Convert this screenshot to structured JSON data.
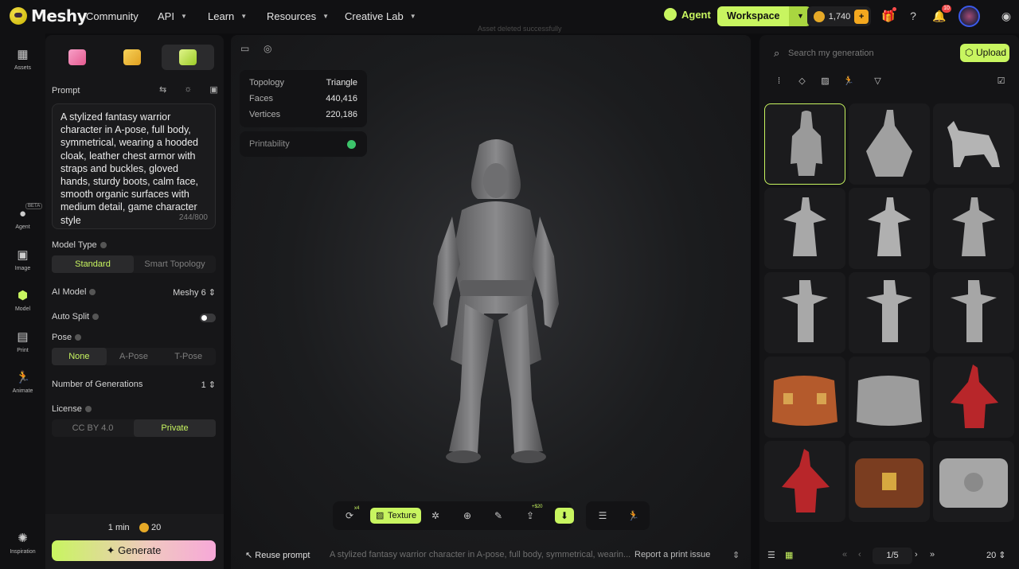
{
  "brand": {
    "name": "Meshy"
  },
  "nav": [
    {
      "label": "Community",
      "dropdown": false
    },
    {
      "label": "API",
      "dropdown": true
    },
    {
      "label": "Learn",
      "dropdown": true
    },
    {
      "label": "Resources",
      "dropdown": true
    },
    {
      "label": "Creative Lab",
      "dropdown": true
    }
  ],
  "header": {
    "agent_label": "Agent",
    "workspace_label": "Workspace",
    "credits": "1,740",
    "notification_count": "10"
  },
  "rail": {
    "items": [
      {
        "label": "Assets",
        "icon": "grid-icon"
      },
      {
        "label": "Agent",
        "icon": "agent-icon",
        "badge": "BETA"
      },
      {
        "label": "Image",
        "icon": "image-plus-icon"
      },
      {
        "label": "Model",
        "icon": "cube-icon"
      },
      {
        "label": "Print",
        "icon": "printer-icon"
      },
      {
        "label": "Animate",
        "icon": "running-figure-icon"
      },
      {
        "label": "Inspiration",
        "icon": "sparkle-icon"
      }
    ]
  },
  "left_panel": {
    "prompt_label": "Prompt",
    "prompt_text": "A stylized fantasy warrior character in A-pose, full body, symmetrical, wearing a hooded cloak, leather chest armor with straps and buckles, gloved hands, sturdy boots, calm face, smooth organic surfaces with medium detail, game character style",
    "prompt_count": "244/800",
    "model_type_label": "Model Type",
    "model_types": [
      "Standard",
      "Smart Topology"
    ],
    "ai_model_label": "AI Model",
    "ai_model_value": "Meshy 6",
    "auto_split_label": "Auto Split",
    "auto_split_on": false,
    "pose_label": "Pose",
    "poses": [
      "None",
      "A-Pose",
      "T-Pose"
    ],
    "generations_label": "Number of Generations",
    "generations_value": "1",
    "license_label": "License",
    "licenses": [
      "CC BY 4.0",
      "Private"
    ],
    "time": "1 min",
    "cost": "20",
    "generate_label": "Generate"
  },
  "viewport": {
    "toast": "Asset deleted successfully",
    "stats": [
      {
        "key": "Topology",
        "value": "Triangle"
      },
      {
        "key": "Faces",
        "value": "440,416"
      },
      {
        "key": "Vertices",
        "value": "220,186"
      }
    ],
    "printability_label": "Printability",
    "texture_label": "Texture",
    "remesh_badge": "x4",
    "export_badge": "+$20",
    "reuse_label": "Reuse prompt",
    "prompt_preview": "A stylized fantasy warrior character in A-pose, full body, symmetrical, wearin...",
    "report_label": "Report a print issue"
  },
  "right_panel": {
    "search_placeholder": "Search my generation",
    "upload_label": "Upload",
    "page": "1/5",
    "per_page": "20"
  },
  "colors": {
    "accent": "#c8f560",
    "background": "#0d0d0f",
    "panel": "#161618"
  }
}
